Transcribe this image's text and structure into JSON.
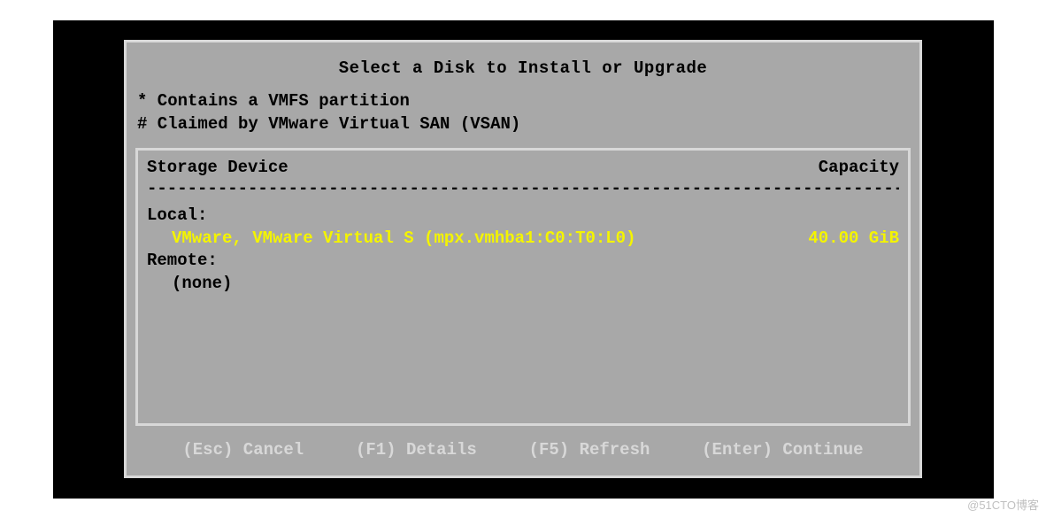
{
  "title": "Select a Disk to Install or Upgrade",
  "legend": {
    "vmfs": "* Contains a VMFS partition",
    "vsan": "# Claimed by VMware Virtual SAN (VSAN)"
  },
  "list": {
    "header_device": "Storage Device",
    "header_capacity": "Capacity",
    "local_label": "Local:",
    "remote_label": "Remote:",
    "remote_none": "(none)",
    "disks": [
      {
        "name": "VMware,  VMware Virtual S (mpx.vmhba1:C0:T0:L0)",
        "capacity": "40.00 GiB"
      }
    ]
  },
  "footer": {
    "cancel": "(Esc) Cancel",
    "details": "(F1) Details",
    "refresh": "(F5) Refresh",
    "continue": "(Enter) Continue"
  },
  "watermark": "@51CTO博客"
}
